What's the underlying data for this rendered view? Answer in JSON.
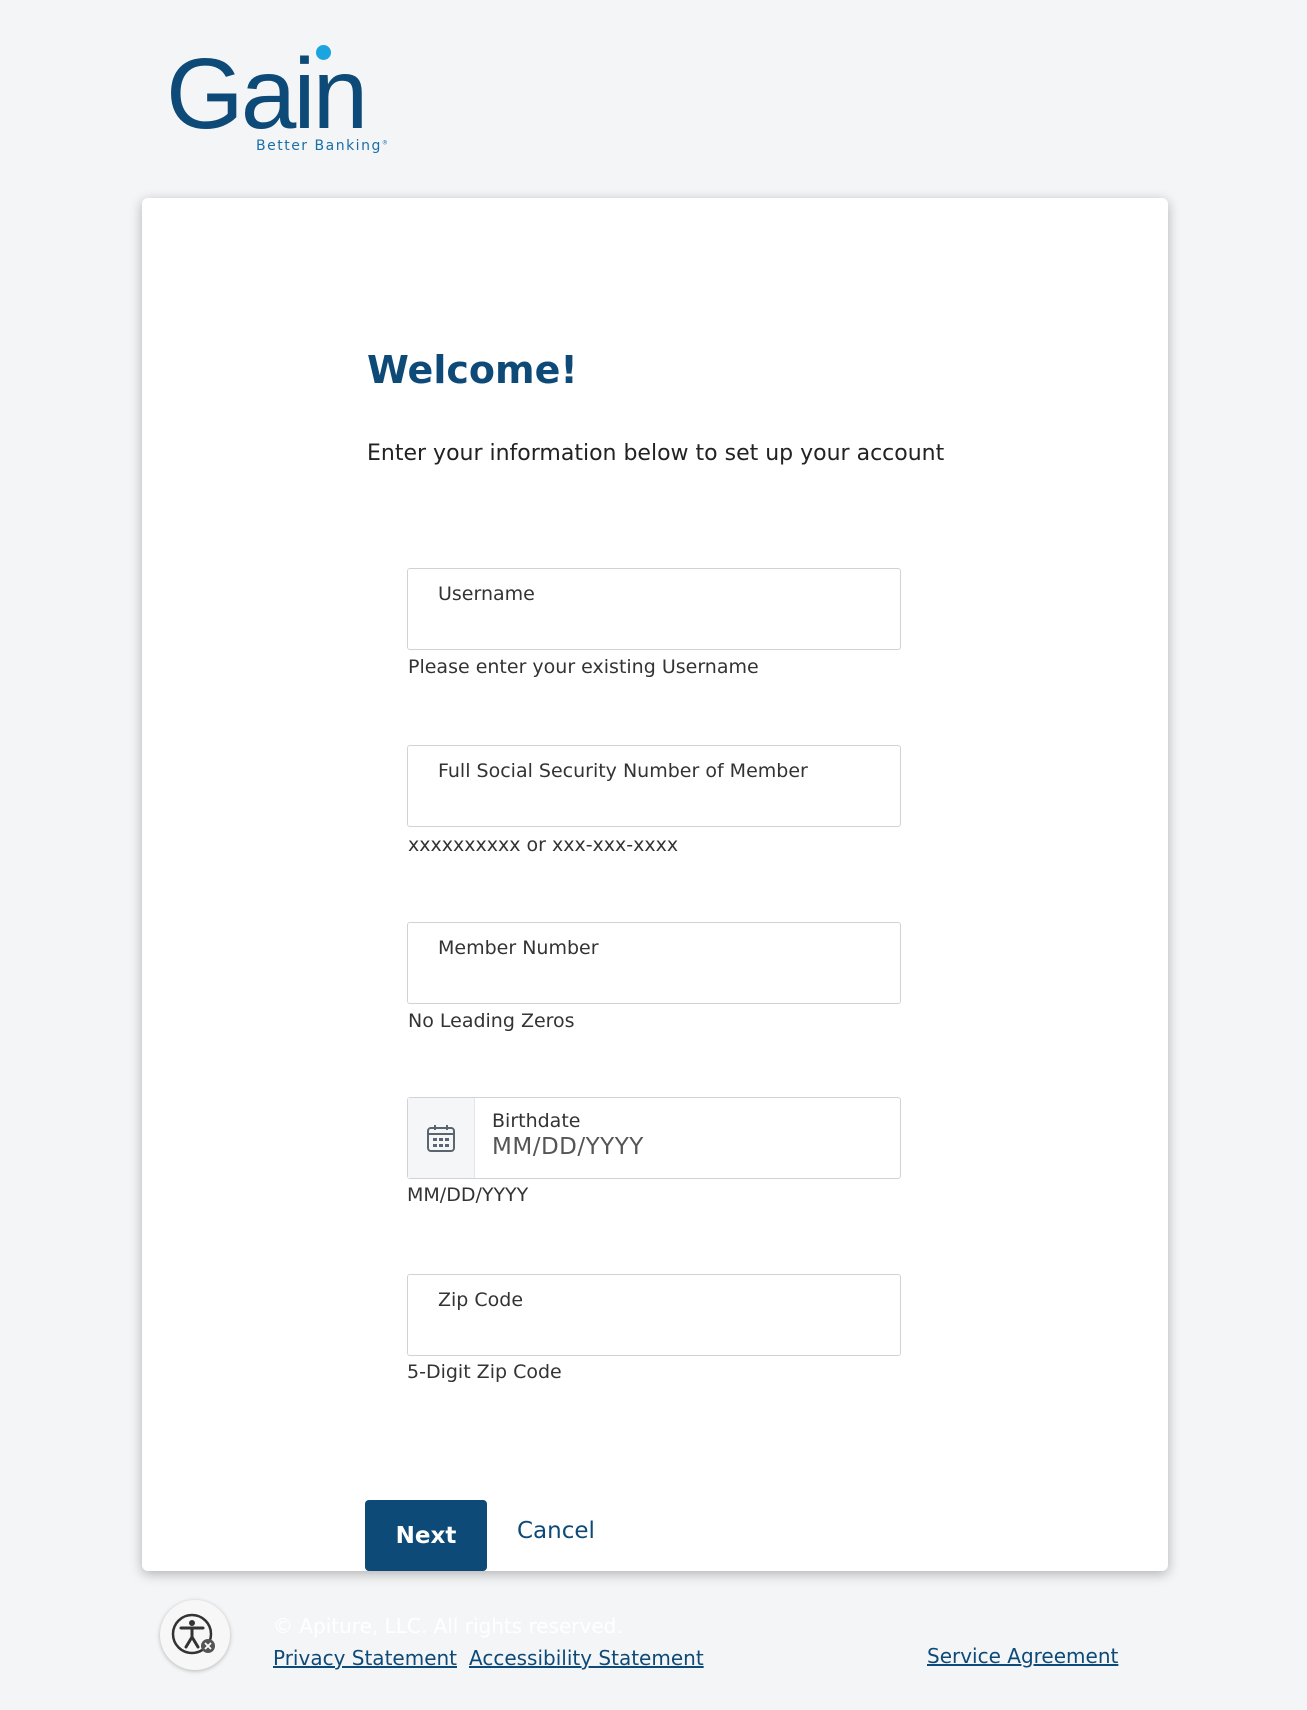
{
  "brand": {
    "name": "Gain",
    "tagline": "Better Banking",
    "trademark": "®",
    "colors": {
      "primary": "#0e4a78",
      "accent": "#1aa4e0"
    }
  },
  "header": {
    "title": "Welcome!",
    "subtitle": "Enter your information below to set up your account"
  },
  "form": {
    "username": {
      "label": "Username",
      "helper": "Please enter your existing Username"
    },
    "ssn": {
      "label": "Full Social Security Number of Member",
      "helper": "xxxxxxxxxx or xxx-xxx-xxxx"
    },
    "member_number": {
      "label": "Member Number",
      "helper": "No Leading Zeros"
    },
    "birthdate": {
      "label": "Birthdate",
      "placeholder": "MM/DD/YYYY",
      "helper": "MM/DD/YYYY",
      "icon": "calendar-icon"
    },
    "zip": {
      "label": "Zip Code",
      "helper": "5-Digit Zip Code"
    }
  },
  "actions": {
    "next_label": "Next",
    "cancel_label": "Cancel"
  },
  "footer": {
    "copyright": "© Apiture, LLC. All rights reserved.",
    "privacy_label": "Privacy Statement",
    "accessibility_label": "Accessibility Statement",
    "service_label": "Service Agreement",
    "accessibility_icon": "accessibility-icon"
  }
}
